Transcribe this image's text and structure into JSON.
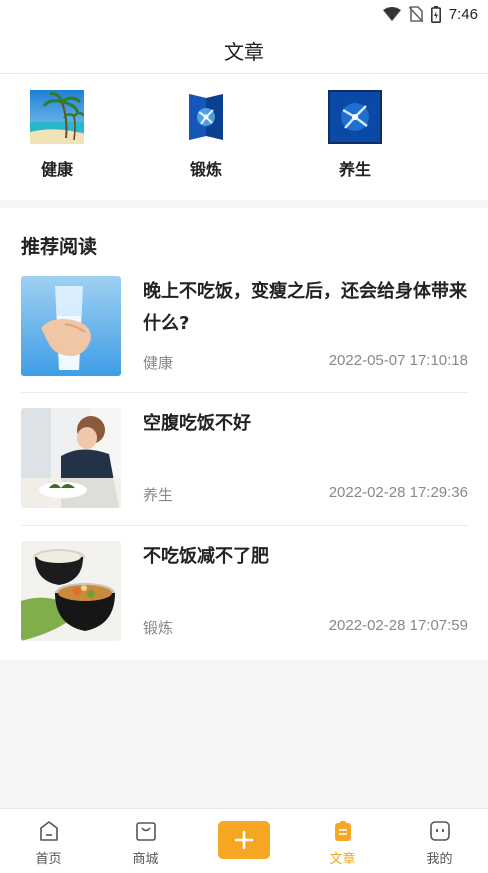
{
  "status_bar": {
    "time": "7:46"
  },
  "header": {
    "title": "文章"
  },
  "categories": [
    {
      "label": "健康",
      "icon": "beach-photo"
    },
    {
      "label": "锻炼",
      "icon": "blue-bird-photo"
    },
    {
      "label": "养生",
      "icon": "blue-bird-photo"
    }
  ],
  "section": {
    "title": "推荐阅读"
  },
  "articles": [
    {
      "title": "晚上不吃饭，变瘦之后，还会给身体带来什么?",
      "category": "健康",
      "date": "2022-05-07 17:10:18",
      "image": "glass-of-water-photo"
    },
    {
      "title": "空腹吃饭不好",
      "category": "养生",
      "date": "2022-02-28 17:29:36",
      "image": "woman-at-table-photo"
    },
    {
      "title": "不吃饭减不了肥",
      "category": "锻炼",
      "date": "2022-02-28 17:07:59",
      "image": "soup-bowls-photo"
    }
  ],
  "tabbar": {
    "items": [
      {
        "label": "首页",
        "icon": "home-icon"
      },
      {
        "label": "商城",
        "icon": "shop-icon"
      },
      {
        "label": "",
        "icon": "plus-icon"
      },
      {
        "label": "文章",
        "icon": "article-icon",
        "active": true
      },
      {
        "label": "我的",
        "icon": "profile-icon"
      }
    ]
  },
  "colors": {
    "accent": "#f5a623",
    "text": "#222222",
    "muted": "#888888"
  }
}
